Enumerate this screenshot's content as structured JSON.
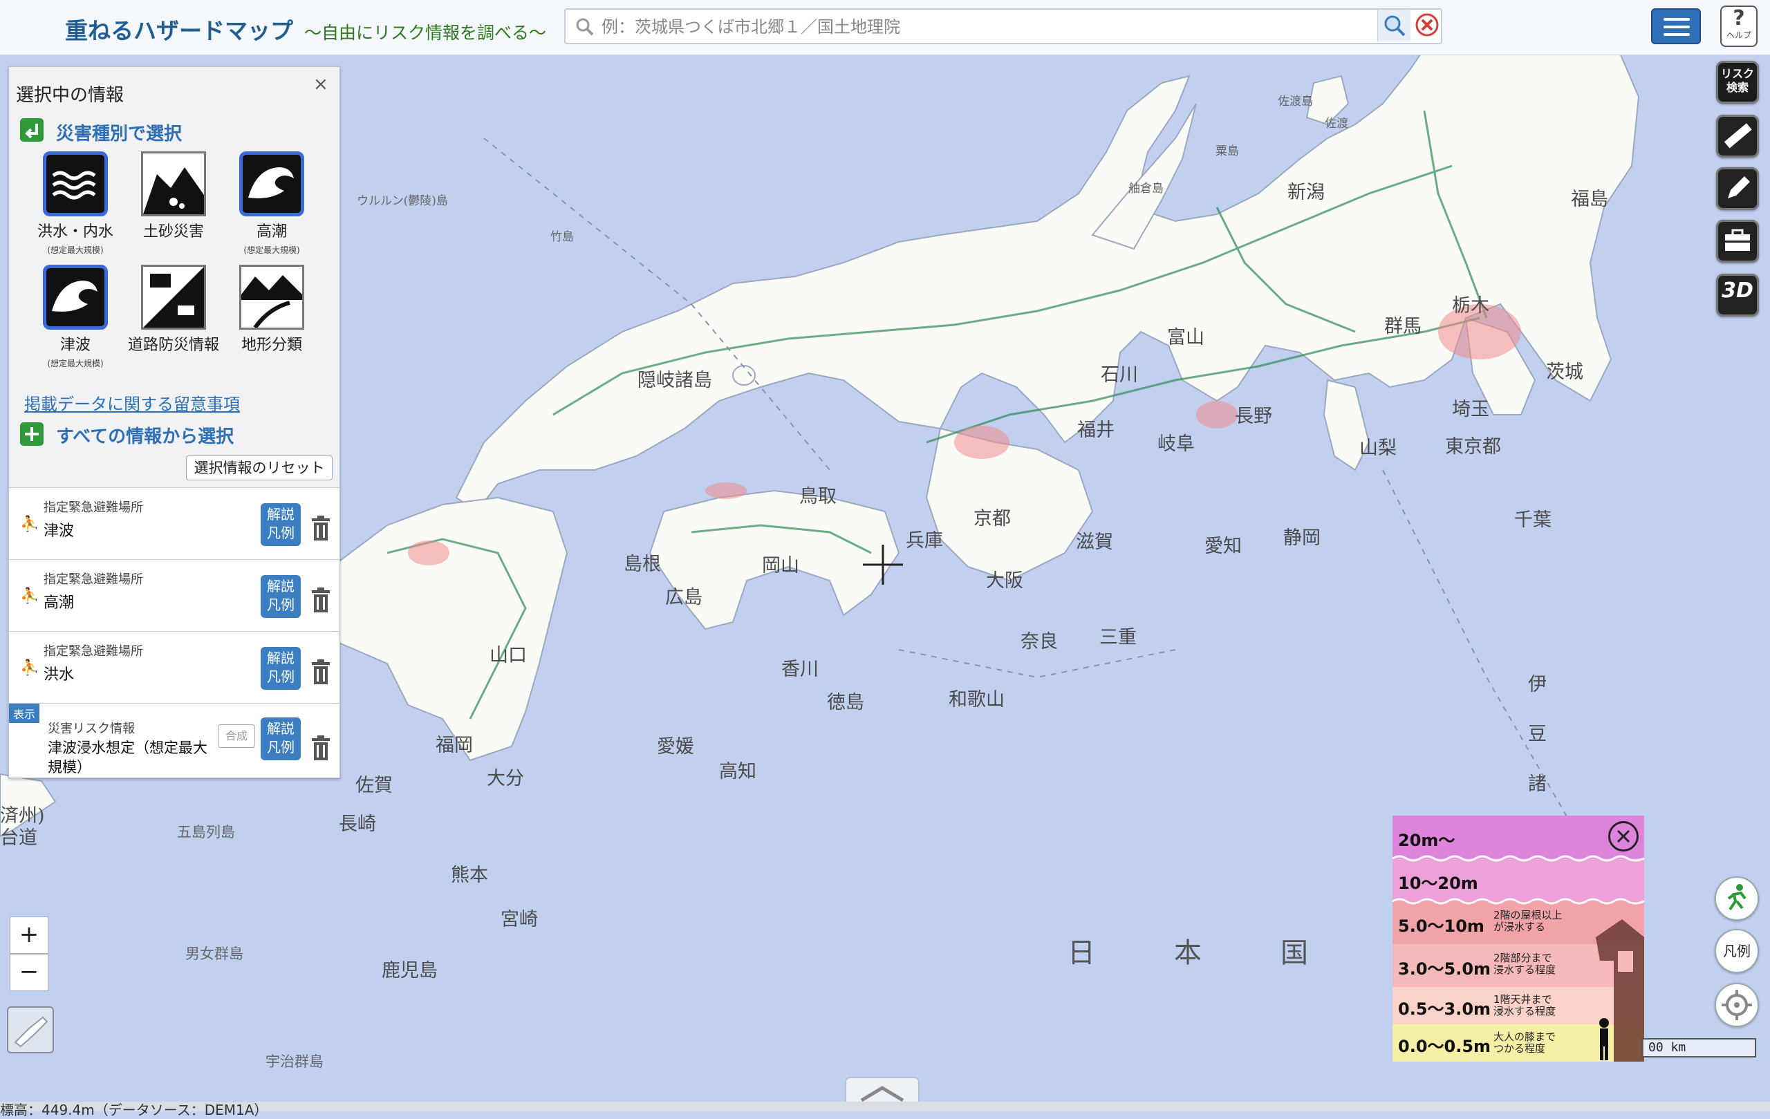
{
  "header": {
    "title": "重ねるハザードマップ",
    "subtitle": "～自由にリスク情報を調べる～",
    "search_placeholder": "例：茨城県つくば市北郷１／国土地理院"
  },
  "tools": {
    "risk_search": "リスク検索",
    "three_d": "3D",
    "legend_btn": "凡例",
    "help": "ヘルプ"
  },
  "panel": {
    "title": "選択中の情報",
    "close": "×",
    "section_hazard": "災害種別で選択",
    "hazards": [
      {
        "label": "洪水・内水",
        "note": "(想定最大規模)"
      },
      {
        "label": "土砂災害",
        "note": ""
      },
      {
        "label": "高潮",
        "note": "(想定最大規模)"
      },
      {
        "label": "津波",
        "note": "(想定最大規模)"
      },
      {
        "label": "道路防災情報",
        "note": ""
      },
      {
        "label": "地形分類",
        "note": ""
      }
    ],
    "notice_link": "掲載データに関する留意事項",
    "section_all": "すべての情報から選択",
    "reset": "選択情報のリセット",
    "legend_label_1": "解説",
    "legend_label_2": "凡例",
    "layers": [
      {
        "category": "指定緊急避難場所",
        "name": "津波"
      },
      {
        "category": "指定緊急避難場所",
        "name": "高潮"
      },
      {
        "category": "指定緊急避難場所",
        "name": "洪水"
      }
    ],
    "risk_layer": {
      "badge": "表示",
      "category": "災害リスク情報",
      "name_line1": "津波浸水想定（想定最大",
      "name_line2": "規模）",
      "composite": "合成"
    }
  },
  "zoom": {
    "in": "+",
    "out": "−"
  },
  "legend": {
    "rows": [
      {
        "range": "20m～",
        "desc1": "",
        "desc2": "",
        "color": "#df84dc"
      },
      {
        "range": "10～20m",
        "desc1": "",
        "desc2": "",
        "color": "#eea0d8"
      },
      {
        "range": "5.0～10m",
        "desc1": "2階の屋根以上",
        "desc2": "が浸水する",
        "color": "#f1a3a8"
      },
      {
        "range": "3.0～5.0m",
        "desc1": "2階部分まで",
        "desc2": "浸水する程度",
        "color": "#f6b9b9"
      },
      {
        "range": "0.5～3.0m",
        "desc1": "1階天井まで",
        "desc2": "浸水する程度",
        "color": "#fbd2c7"
      },
      {
        "range": "0.0～0.5m",
        "desc1": "大人の膝まで",
        "desc2": "つかる程度",
        "color": "#f5f0a6"
      }
    ]
  },
  "scale": "00 km",
  "status": "標高：449.4m（データソース：DEM1A）",
  "map": {
    "sea_label": [
      "日",
      "本",
      "国"
    ],
    "regions": [
      {
        "name": "新潟",
        "cls": "pref"
      },
      {
        "name": "福島",
        "cls": "pref"
      },
      {
        "name": "富山",
        "cls": "pref"
      },
      {
        "name": "石川",
        "cls": "pref"
      },
      {
        "name": "長野",
        "cls": "pref"
      },
      {
        "name": "群馬",
        "cls": "pref"
      },
      {
        "name": "栃木",
        "cls": "pref"
      },
      {
        "name": "茨城",
        "cls": "pref"
      },
      {
        "name": "埼玉",
        "cls": "pref"
      },
      {
        "name": "東京都",
        "cls": "pref"
      },
      {
        "name": "千葉",
        "cls": "pref"
      },
      {
        "name": "山梨",
        "cls": "pref"
      },
      {
        "name": "静岡",
        "cls": "pref"
      },
      {
        "name": "愛知",
        "cls": "pref"
      },
      {
        "name": "岐阜",
        "cls": "pref"
      },
      {
        "name": "福井",
        "cls": "pref"
      },
      {
        "name": "京都",
        "cls": "pref"
      },
      {
        "name": "滋賀",
        "cls": "pref"
      },
      {
        "name": "三重",
        "cls": "pref"
      },
      {
        "name": "奈良",
        "cls": "pref"
      },
      {
        "name": "和歌山",
        "cls": "pref"
      },
      {
        "name": "大阪",
        "cls": "pref"
      },
      {
        "name": "兵庫",
        "cls": "pref"
      },
      {
        "name": "鳥取",
        "cls": "pref"
      },
      {
        "name": "岡山",
        "cls": "pref"
      },
      {
        "name": "島根",
        "cls": "pref"
      },
      {
        "name": "広島",
        "cls": "pref"
      },
      {
        "name": "山口",
        "cls": "pref"
      },
      {
        "name": "香川",
        "cls": "pref"
      },
      {
        "name": "徳島",
        "cls": "pref"
      },
      {
        "name": "愛媛",
        "cls": "pref"
      },
      {
        "name": "高知",
        "cls": "pref"
      },
      {
        "name": "福岡",
        "cls": "pref"
      },
      {
        "name": "大分",
        "cls": "pref"
      },
      {
        "name": "佐賀",
        "cls": "pref"
      },
      {
        "name": "長崎",
        "cls": "pref"
      },
      {
        "name": "熊本",
        "cls": "pref"
      },
      {
        "name": "宮崎",
        "cls": "pref"
      },
      {
        "name": "鹿児島",
        "cls": "pref"
      },
      {
        "name": "隠岐諸島",
        "cls": "pref"
      },
      {
        "name": "伊",
        "cls": "pref"
      },
      {
        "name": "豆",
        "cls": "pref"
      },
      {
        "name": "諸",
        "cls": "pref"
      },
      {
        "name": "五島列島",
        "cls": "small"
      },
      {
        "name": "男女群島",
        "cls": "small"
      },
      {
        "name": "宇治群島",
        "cls": "small"
      },
      {
        "name": "竹島",
        "cls": "small"
      },
      {
        "name": "ウルルン(鬱陵)島",
        "cls": "small"
      },
      {
        "name": "佐渡島",
        "cls": "small"
      },
      {
        "name": "佐渡",
        "cls": "small"
      },
      {
        "name": "粟島",
        "cls": "small"
      },
      {
        "name": "舳倉島",
        "cls": "small"
      },
      {
        "name": "済州)",
        "cls": "pref"
      },
      {
        "name": "台道",
        "cls": "pref"
      }
    ]
  }
}
